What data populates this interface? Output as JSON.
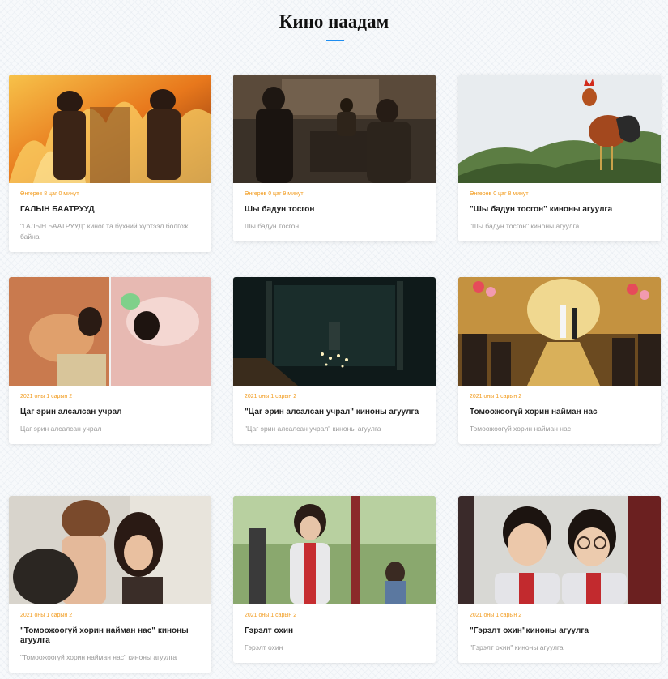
{
  "page": {
    "title": "Кино наадам"
  },
  "colors": {
    "accent": "#1f8ef1",
    "date": "#f29b1d"
  },
  "cards": [
    {
      "date": "Өнгөрөв 8 цаг 0 минут",
      "title": "ГАЛЫН БААТРУУД",
      "desc": "\"ГАЛЫН БААТРУУД\" киног та бүхний хүртээл болгож байна",
      "image": "firefighters-in-flames"
    },
    {
      "date": "Өнгөрөв 0 цаг 9 минут",
      "title": "Шы бадун тосгон",
      "desc": "Шы бадун тосгон",
      "image": "men-in-restaurant"
    },
    {
      "date": "Өнгөрөв 0 цаг 8 минут",
      "title": "\"Шы бадун тосгон\" киноны агуулга",
      "desc": "\"Шы бадун тосгон\" киноны агуулга",
      "image": "rooster-on-mountain"
    },
    {
      "date": "2021 оны 1 сарын 2",
      "title": "Цаг эрин алсалсан учрал",
      "desc": "Цаг эрин алсалсан учрал",
      "image": "split-screen-bed"
    },
    {
      "date": "2021 оны 1 сарын 2",
      "title": "\"Цаг эрин алсалсан учрал\" киноны агуулга",
      "desc": "\"Цаг эрин алсалсан учрал\" киноны агуулга",
      "image": "candle-hall"
    },
    {
      "date": "2021 оны 1 сарын 2",
      "title": "Томоожоогүй хорин найман нас",
      "desc": "Томоожоогүй хорин найман нас",
      "image": "wedding-ceremony"
    },
    {
      "date": "2021 оны 1 сарын 2",
      "title": "\"Томоожоогүй хорин найман нас\" киноны агуулга",
      "desc": "\"Томоожоогүй хорин найман нас\" киноны агуулга",
      "image": "two-women"
    },
    {
      "date": "2021 оны 1 сарын 2",
      "title": "Гэрэлт охин",
      "desc": "Гэрэлт охин",
      "image": "girl-in-tracksuit"
    },
    {
      "date": "2021 оны 1 сарын 2",
      "title": "\"Гэрэлт охин\"киноны агуулга",
      "desc": "\"Гэрэлт охин\" киноны агуулга",
      "image": "boy-and-girl-school"
    }
  ]
}
